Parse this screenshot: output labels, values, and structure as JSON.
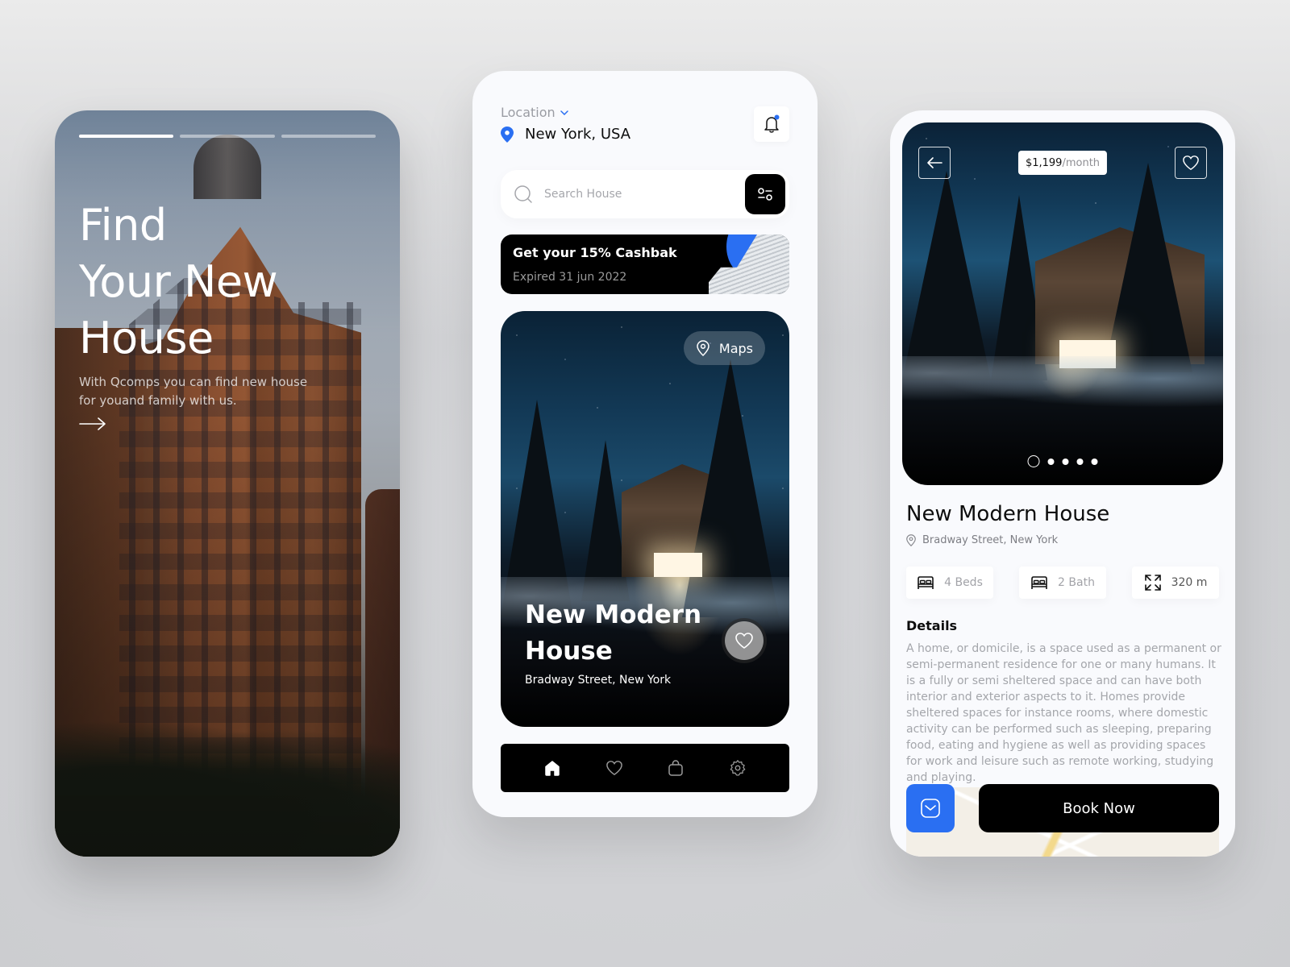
{
  "onboarding": {
    "progress": {
      "total_steps": 3,
      "current_step": 1
    },
    "title_lines": [
      "Find",
      "Your New",
      "House"
    ],
    "subtitle": "With Qcomps you can find new house for youand family with us.",
    "next_icon": "arrow-right-icon"
  },
  "home": {
    "location_label": "Location",
    "location_value": "New York, USA",
    "notification_icon": "bell-icon",
    "search": {
      "placeholder": "Search House",
      "value": ""
    },
    "filter_icon": "filter-icon",
    "promo": {
      "title": "Get your 15% Cashbak",
      "subtitle": "Expired 31 jun 2022"
    },
    "featured": {
      "maps_label": "Maps",
      "title_lines": [
        "New Modern",
        "House"
      ],
      "address": "Bradway Street, New York",
      "favorite_icon": "heart-icon"
    },
    "tabbar": [
      {
        "icon": "home-icon",
        "active": true
      },
      {
        "icon": "heart-icon",
        "active": false
      },
      {
        "icon": "bag-icon",
        "active": false
      },
      {
        "icon": "gear-icon",
        "active": false
      }
    ]
  },
  "detail": {
    "price": "$1,199",
    "price_period": "/month",
    "gallery": {
      "total_images": 5,
      "current_index": 1
    },
    "title": "New Modern House",
    "address": "Bradway Street, New York",
    "features": [
      {
        "icon": "bed-icon",
        "label": "4 Beds"
      },
      {
        "icon": "bed-icon",
        "label": "2 Bath"
      },
      {
        "icon": "expand-icon",
        "label": "320 m"
      }
    ],
    "details_heading": "Details",
    "details_text": "A home, or domicile, is a space used as a permanent or semi-permanent residence for one or many humans. It is a fully or semi sheltered space and can have both interior and exterior aspects to it. Homes provide sheltered spaces for instance rooms, where domestic activity can be performed such as sleeping, preparing food, eating and hygiene as well as providing spaces for work and leisure such as remote working, studying and playing.",
    "book_label": "Book Now"
  },
  "colors": {
    "accent": "#2a6ff2",
    "dark": "#000000",
    "muted_text": "#a4a6ab",
    "card_bg": "#f9fafd"
  }
}
